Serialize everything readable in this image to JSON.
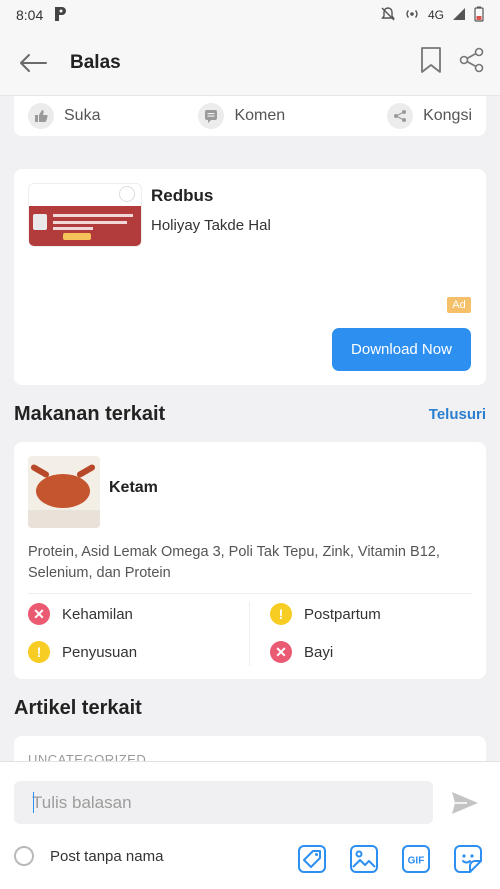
{
  "status_bar": {
    "time": "8:04",
    "network": "4G"
  },
  "header": {
    "title": "Balas"
  },
  "reactions": {
    "like": "Suka",
    "comment": "Komen",
    "share": "Kongsi"
  },
  "ad": {
    "title": "Redbus",
    "subtitle": "Holiyay Takde Hal",
    "badge": "Ad",
    "cta": "Download Now"
  },
  "related_food": {
    "heading": "Makanan terkait",
    "link": "Telusuri",
    "name": "Ketam",
    "nutrients": "Protein, Asid Lemak Omega 3, Poli Tak Tepu, Zink, Vitamin B12, Selenium, dan Protein",
    "safety": [
      {
        "label": "Kehamilan",
        "status": "not-safe",
        "symbol": "✕"
      },
      {
        "label": "Postpartum",
        "status": "caution",
        "symbol": "!"
      },
      {
        "label": "Penyusuan",
        "status": "caution",
        "symbol": "!"
      },
      {
        "label": "Bayi",
        "status": "not-safe",
        "symbol": "✕"
      }
    ]
  },
  "related_articles": {
    "heading": "Artikel terkait",
    "category": "UNCATEGORIZED"
  },
  "composer": {
    "placeholder": "Tulis balasan",
    "anonymous_label": "Post tanpa nama"
  },
  "colors": {
    "accent": "#2d8ff0",
    "link": "#2a7fd0",
    "not_safe": "#ea5a72",
    "caution": "#f7cc23",
    "ad_badge": "#f4c06a"
  }
}
